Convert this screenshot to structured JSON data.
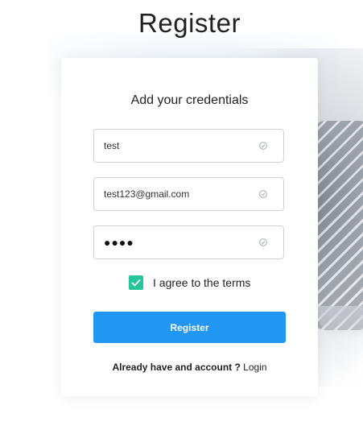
{
  "page": {
    "title": "Register"
  },
  "form": {
    "subtitle": "Add your credentials",
    "username": {
      "value": "test"
    },
    "email": {
      "value": "test123@gmail.com"
    },
    "password": {
      "masked": "●●●●"
    },
    "terms_label": "I agree to the terms",
    "terms_checked": true,
    "submit_label": "Register",
    "account_question": "Already have and account ?",
    "login_link": "Login"
  },
  "colors": {
    "primary_button": "#2196f3",
    "checkbox": "#26c59a"
  },
  "icons": {
    "field_valid": "check-circle-icon",
    "checkbox_mark": "checkmark-icon"
  }
}
